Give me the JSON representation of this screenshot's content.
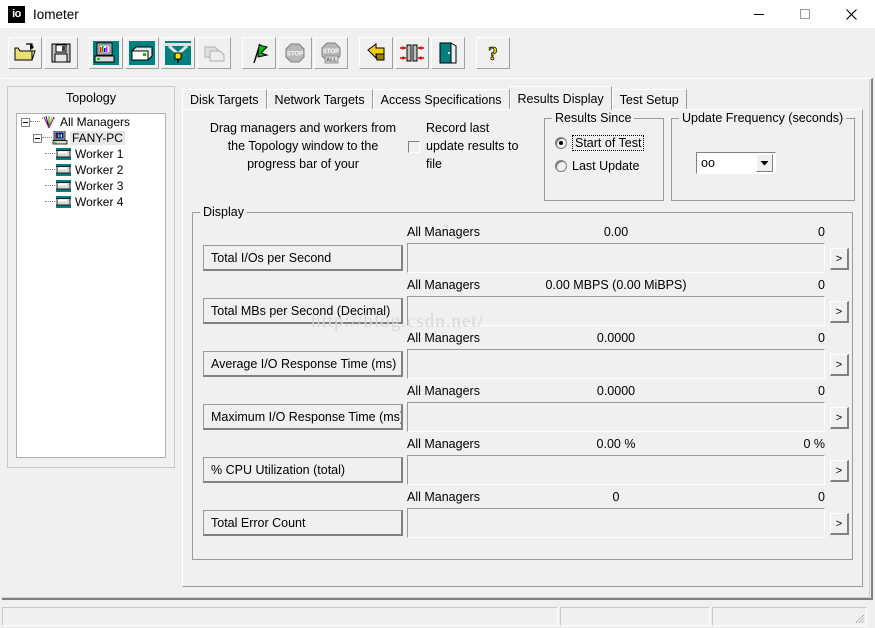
{
  "window": {
    "title": "Iometer",
    "app_icon": "io",
    "minimize_label": "Minimize",
    "maximize_label": "Maximize",
    "close_label": "Close"
  },
  "toolbar": {
    "groups": [
      [
        {
          "name": "open-config-icon",
          "label": "Open test configuration file"
        },
        {
          "name": "save-config-icon",
          "label": "Save test configuration file"
        }
      ],
      [
        {
          "name": "new-manager-icon",
          "label": "Start Dynamo on local machine"
        },
        {
          "name": "new-worker-icon",
          "label": "Start worker"
        },
        {
          "name": "disconnect-icon",
          "label": "Disconnect selected worker or manager"
        },
        {
          "name": "duplicate-disabled-icon",
          "label": "Duplicate"
        }
      ],
      [
        {
          "name": "start-test-icon",
          "label": "Start Tests"
        },
        {
          "name": "stop-test-icon",
          "label": "Stop current test"
        },
        {
          "name": "stop-all-icon",
          "label": "Stop all tests"
        }
      ],
      [
        {
          "name": "reset-icon",
          "label": "Reset configuration"
        },
        {
          "name": "replicate-icon",
          "label": "Replicate settings to all workers"
        },
        {
          "name": "exit-icon",
          "label": "Exit"
        }
      ],
      [
        {
          "name": "help-icon",
          "label": "Help"
        }
      ]
    ]
  },
  "topology": {
    "title": "Topology",
    "nodes": [
      {
        "label": "All Managers",
        "icon": "all-managers-icon",
        "depth": 0,
        "expander": true,
        "selected": false
      },
      {
        "label": "FANY-PC",
        "icon": "manager-icon",
        "depth": 1,
        "expander": true,
        "selected": true
      },
      {
        "label": "Worker 1",
        "icon": "worker-icon",
        "depth": 2,
        "expander": false,
        "selected": false
      },
      {
        "label": "Worker 2",
        "icon": "worker-icon",
        "depth": 2,
        "expander": false,
        "selected": false
      },
      {
        "label": "Worker 3",
        "icon": "worker-icon",
        "depth": 2,
        "expander": false,
        "selected": false
      },
      {
        "label": "Worker 4",
        "icon": "worker-icon",
        "depth": 2,
        "expander": false,
        "selected": false
      }
    ]
  },
  "tabs": [
    {
      "label": "Disk Targets",
      "active": false
    },
    {
      "label": "Network Targets",
      "active": false
    },
    {
      "label": "Access Specifications",
      "active": false
    },
    {
      "label": "Results Display",
      "active": true
    },
    {
      "label": "Test Setup",
      "active": false
    }
  ],
  "results_display": {
    "drag_hint": "Drag managers and workers from the Topology window to the progress bar of your",
    "record_checkbox": {
      "label": "Record last update results to file",
      "checked": false
    },
    "results_since": {
      "title": "Results Since",
      "options": [
        {
          "label": "Start of Test",
          "selected": true,
          "focused": true
        },
        {
          "label": "Last Update",
          "selected": false,
          "focused": false
        }
      ]
    },
    "update_frequency": {
      "title": "Update Frequency (seconds)",
      "value": "oo"
    },
    "display": {
      "title": "Display",
      "more_button_label": ">",
      "rows": [
        {
          "button_label": "Total I/Os per Second",
          "scope": "All Managers",
          "value": "0.00",
          "max": "0",
          "progress": 0
        },
        {
          "button_label": "Total MBs per Second (Decimal)",
          "scope": "All Managers",
          "value": "0.00 MBPS (0.00 MiBPS)",
          "max": "0",
          "progress": 0
        },
        {
          "button_label": "Average I/O Response Time (ms)",
          "scope": "All Managers",
          "value": "0.0000",
          "max": "0",
          "progress": 0
        },
        {
          "button_label": "Maximum I/O Response Time (ms)",
          "scope": "All Managers",
          "value": "0.0000",
          "max": "0",
          "progress": 0
        },
        {
          "button_label": "% CPU Utilization (total)",
          "scope": "All Managers",
          "value": "0.00 %",
          "max": "0 %",
          "progress": 0
        },
        {
          "button_label": "Total Error Count",
          "scope": "All Managers",
          "value": "0",
          "max": "0",
          "progress": 0
        }
      ]
    }
  },
  "watermark": "http://blog.csdn.net/",
  "statusbar": {
    "pane1": "",
    "pane2": "",
    "pane3": ""
  }
}
